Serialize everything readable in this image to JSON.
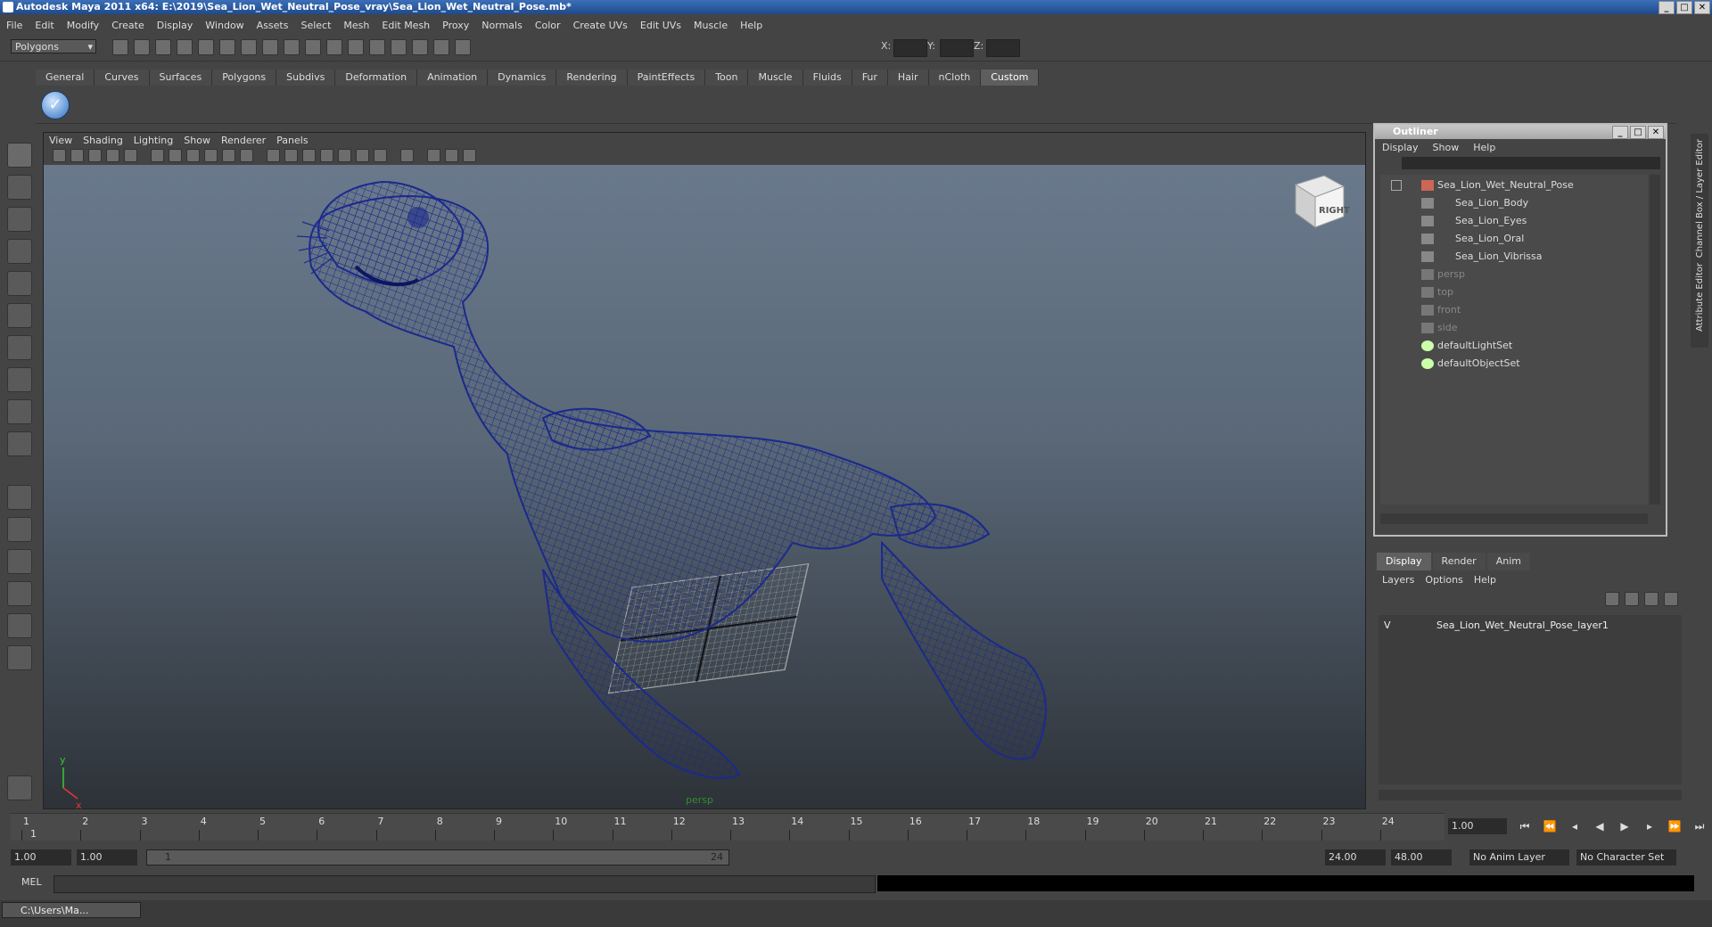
{
  "window": {
    "title": "Autodesk Maya 2011 x64: E:\\2019\\Sea_Lion_Wet_Neutral_Pose_vray\\Sea_Lion_Wet_Neutral_Pose.mb*"
  },
  "menubar": [
    "File",
    "Edit",
    "Modify",
    "Create",
    "Display",
    "Window",
    "Assets",
    "Select",
    "Mesh",
    "Edit Mesh",
    "Proxy",
    "Normals",
    "Color",
    "Create UVs",
    "Edit UVs",
    "Muscle",
    "Help"
  ],
  "statusline": {
    "mode": "Polygons",
    "x_label": "X:",
    "y_label": "Y:",
    "z_label": "Z:"
  },
  "shelf": {
    "tabs": [
      "General",
      "Curves",
      "Surfaces",
      "Polygons",
      "Subdivs",
      "Deformation",
      "Animation",
      "Dynamics",
      "Rendering",
      "PaintEffects",
      "Toon",
      "Muscle",
      "Fluids",
      "Fur",
      "Hair",
      "nCloth",
      "Custom"
    ],
    "active": "Custom"
  },
  "viewport": {
    "menu": [
      "View",
      "Shading",
      "Lighting",
      "Show",
      "Renderer",
      "Panels"
    ],
    "camera_label": "persp",
    "viewcube_label": "RIGHT",
    "axis_y": "y",
    "axis_x": "x",
    "wire_color": "#1b2a8c"
  },
  "outliner": {
    "title": "Outliner",
    "menu": [
      "Display",
      "Show",
      "Help"
    ],
    "items": [
      {
        "label": "Sea_Lion_Wet_Neutral_Pose",
        "icon": "transform-icon",
        "dim": false
      },
      {
        "label": "Sea_Lion_Body",
        "icon": "mesh-icon",
        "dim": false
      },
      {
        "label": "Sea_Lion_Eyes",
        "icon": "mesh-icon",
        "dim": false
      },
      {
        "label": "Sea_Lion_Oral",
        "icon": "mesh-icon",
        "dim": false
      },
      {
        "label": "Sea_Lion_Vibrissa",
        "icon": "mesh-icon",
        "dim": false
      },
      {
        "label": "persp",
        "icon": "camera-icon",
        "dim": true
      },
      {
        "label": "top",
        "icon": "camera-icon",
        "dim": true
      },
      {
        "label": "front",
        "icon": "camera-icon",
        "dim": true
      },
      {
        "label": "side",
        "icon": "camera-icon",
        "dim": true
      },
      {
        "label": "defaultLightSet",
        "icon": "set-icon",
        "dim": false
      },
      {
        "label": "defaultObjectSet",
        "icon": "set-icon",
        "dim": false
      }
    ]
  },
  "layers": {
    "tabs": [
      "Display",
      "Render",
      "Anim"
    ],
    "active": "Display",
    "menu": [
      "Layers",
      "Options",
      "Help"
    ],
    "visible_flag": "V",
    "layer_name": "Sea_Lion_Wet_Neutral_Pose_layer1"
  },
  "right_strip": [
    "Channel Box / Layer Editor",
    "Attribute Editor"
  ],
  "timeline": {
    "ticks": [
      "1",
      "2",
      "3",
      "4",
      "5",
      "6",
      "7",
      "8",
      "9",
      "10",
      "11",
      "12",
      "13",
      "14",
      "15",
      "16",
      "17",
      "18",
      "19",
      "20",
      "21",
      "22",
      "23",
      "24"
    ],
    "current_frame_label": "1",
    "current_frame": "1.00"
  },
  "range": {
    "start": "1.00",
    "playback_start": "1.00",
    "slider_start": "1",
    "slider_end": "24",
    "playback_end": "24.00",
    "end": "48.00",
    "anim_layer": "No Anim Layer",
    "character_set": "No Character Set"
  },
  "cmdline": {
    "label": "MEL"
  },
  "taskbar": {
    "item": "C:\\Users\\Ma..."
  }
}
